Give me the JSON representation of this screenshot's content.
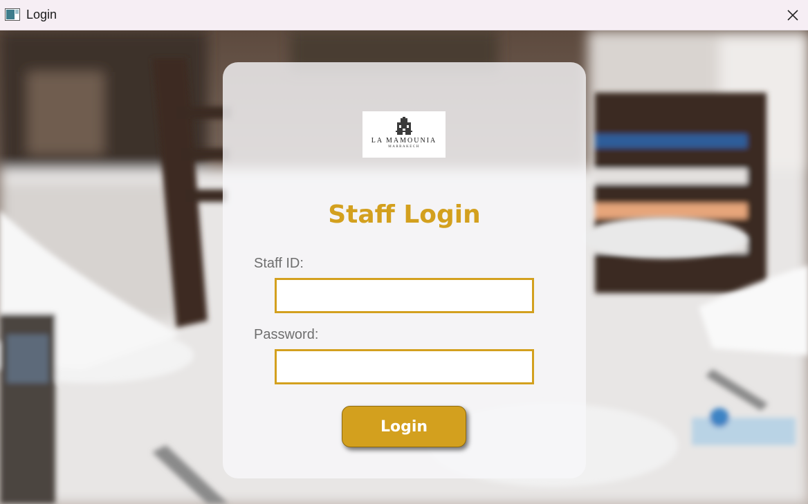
{
  "window": {
    "title": "Login",
    "icon": "app-window-icon",
    "close_icon": "close-icon"
  },
  "logo": {
    "name": "LA MAMOUNIA",
    "subtitle": "MARRAKECH"
  },
  "form": {
    "heading": "Staff Login",
    "staff_id_label": "Staff ID:",
    "staff_id_value": "",
    "password_label": "Password:",
    "password_value": "",
    "login_label": "Login"
  },
  "colors": {
    "accent": "#d3a01e",
    "card": "#f8f8fa",
    "titlebar": "#f6eef4"
  }
}
